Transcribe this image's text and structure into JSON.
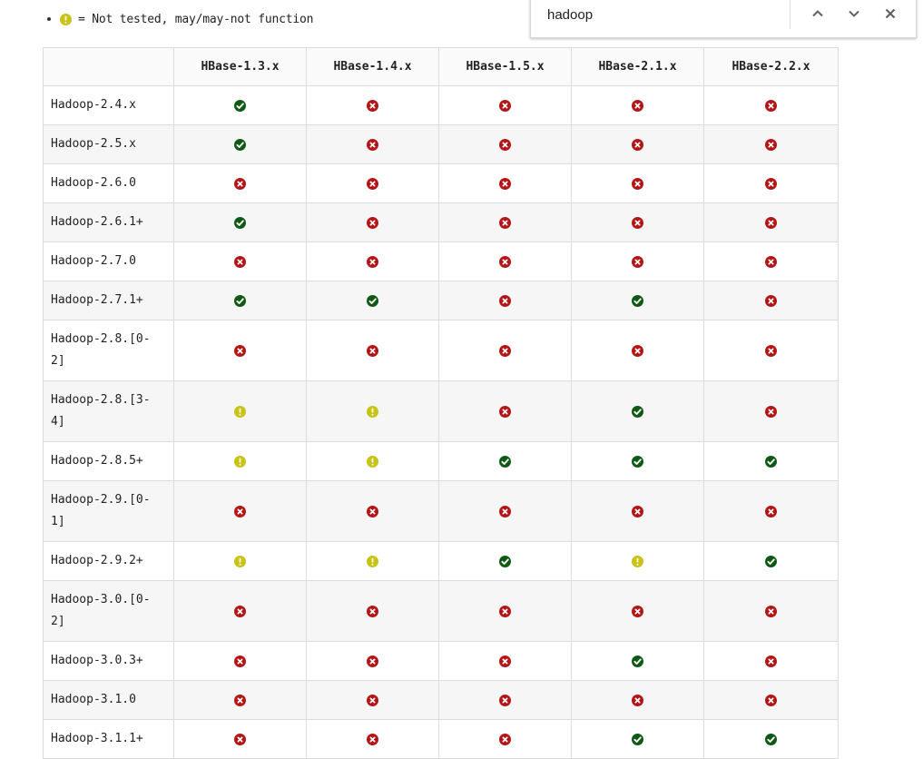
{
  "legend": {
    "icon": "warning-icon",
    "text": "= Not tested, may/may-not function"
  },
  "find_bar": {
    "query": "hadoop",
    "icons": [
      "chevron-up-icon",
      "chevron-down-icon",
      "close-icon"
    ]
  },
  "colors": {
    "supported": "#0e5a14",
    "unsupported": "#b31616",
    "untested": "#c9c217"
  },
  "table": {
    "columns": [
      "",
      "HBase-1.3.x",
      "HBase-1.4.x",
      "HBase-1.5.x",
      "HBase-2.1.x",
      "HBase-2.2.x"
    ],
    "rows": [
      {
        "label": "Hadoop-2.4.x",
        "cells": [
          "yes",
          "no",
          "no",
          "no",
          "no"
        ]
      },
      {
        "label": "Hadoop-2.5.x",
        "cells": [
          "yes",
          "no",
          "no",
          "no",
          "no"
        ]
      },
      {
        "label": "Hadoop-2.6.0",
        "cells": [
          "no",
          "no",
          "no",
          "no",
          "no"
        ]
      },
      {
        "label": "Hadoop-2.6.1+",
        "cells": [
          "yes",
          "no",
          "no",
          "no",
          "no"
        ]
      },
      {
        "label": "Hadoop-2.7.0",
        "cells": [
          "no",
          "no",
          "no",
          "no",
          "no"
        ]
      },
      {
        "label": "Hadoop-2.7.1+",
        "cells": [
          "yes",
          "yes",
          "no",
          "yes",
          "no"
        ]
      },
      {
        "label": "Hadoop-2.8.[0-2]",
        "cells": [
          "no",
          "no",
          "no",
          "no",
          "no"
        ]
      },
      {
        "label": "Hadoop-2.8.[3-4]",
        "cells": [
          "warn",
          "warn",
          "no",
          "yes",
          "no"
        ]
      },
      {
        "label": "Hadoop-2.8.5+",
        "cells": [
          "warn",
          "warn",
          "yes",
          "yes",
          "yes"
        ]
      },
      {
        "label": "Hadoop-2.9.[0-1]",
        "cells": [
          "no",
          "no",
          "no",
          "no",
          "no"
        ]
      },
      {
        "label": "Hadoop-2.9.2+",
        "cells": [
          "warn",
          "warn",
          "yes",
          "warn",
          "yes"
        ]
      },
      {
        "label": "Hadoop-3.0.[0-2]",
        "cells": [
          "no",
          "no",
          "no",
          "no",
          "no"
        ]
      },
      {
        "label": "Hadoop-3.0.3+",
        "cells": [
          "no",
          "no",
          "no",
          "yes",
          "no"
        ]
      },
      {
        "label": "Hadoop-3.1.0",
        "cells": [
          "no",
          "no",
          "no",
          "no",
          "no"
        ]
      },
      {
        "label": "Hadoop-3.1.1+",
        "cells": [
          "no",
          "no",
          "no",
          "yes",
          "yes"
        ]
      }
    ]
  }
}
